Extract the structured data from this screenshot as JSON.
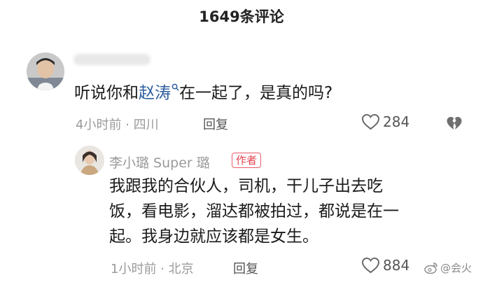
{
  "header": {
    "title": "1649条评论"
  },
  "comment": {
    "text_before": "听说你和",
    "mention": "赵涛",
    "text_after": "在一起了，是真的吗?",
    "time_location": "4小时前 · 四川",
    "reply_label": "回复",
    "like_count": "284"
  },
  "reply": {
    "author": "李小璐 Super 璐",
    "badge": "作者",
    "lines": [
      "我跟我的合伙人，司机，干儿子出去吃",
      "饭，看电影，溜达都被拍过，都说是在一",
      "起。我身边就应该都是女生。"
    ],
    "time_location": "1小时前 · 北京",
    "reply_label": "回复",
    "like_count": "884"
  },
  "watermark": {
    "text": "@会火"
  },
  "icons": {
    "like": "heart-outline-icon",
    "dislike": "broken-heart-icon",
    "mention": "search-icon",
    "watermark": "weibo-logo-icon"
  },
  "colors": {
    "mention": "#2c5d9e",
    "author_badge": "#e3434f"
  }
}
